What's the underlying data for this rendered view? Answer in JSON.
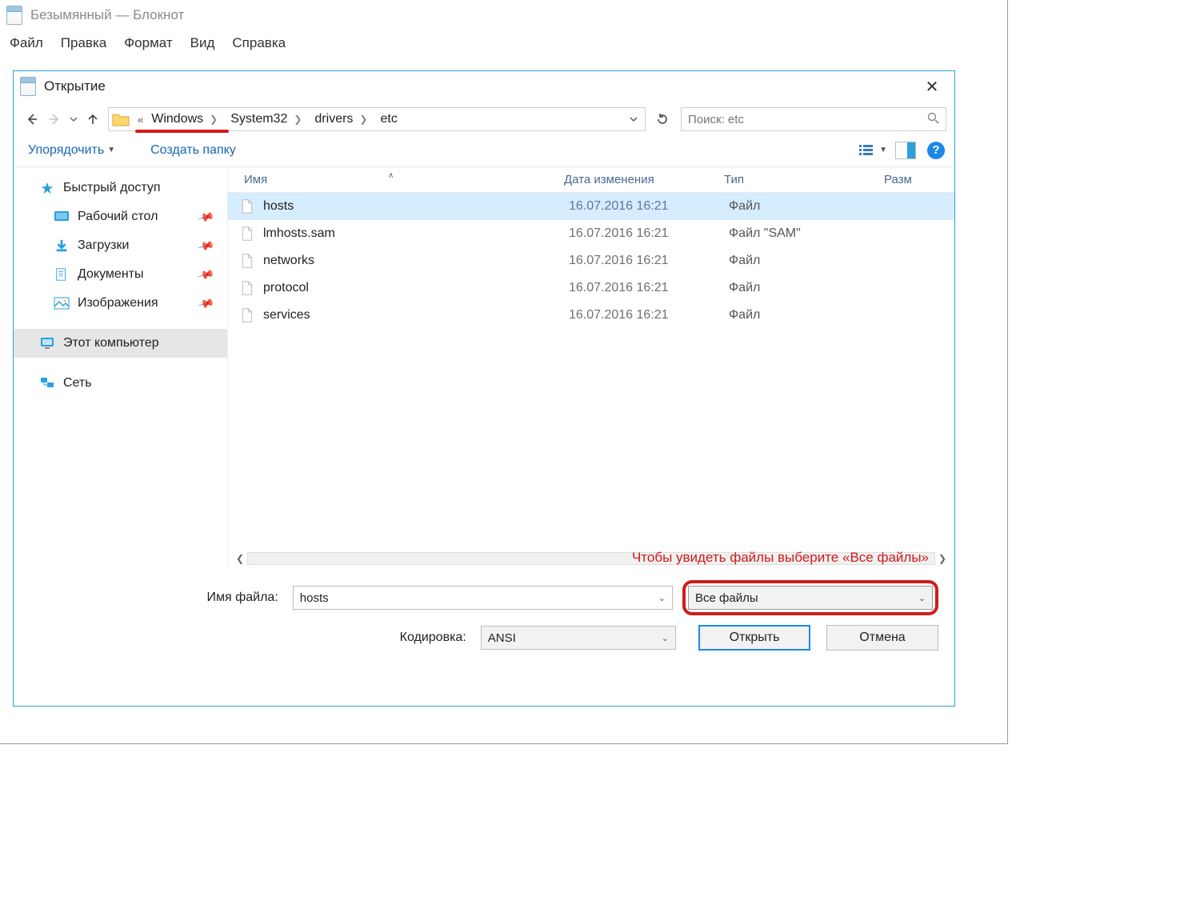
{
  "notepad": {
    "title": "Безымянный — Блокнот",
    "menu": [
      "Файл",
      "Правка",
      "Формат",
      "Вид",
      "Справка"
    ]
  },
  "dialog": {
    "title": "Открытие",
    "breadcrumb": {
      "p0": "Windows",
      "p1": "System32",
      "p2": "drivers",
      "p3": "etc"
    },
    "search_placeholder": "Поиск: etc",
    "toolbar": {
      "organize": "Упорядочить",
      "new_folder": "Создать папку"
    },
    "sidebar": {
      "quick": "Быстрый доступ",
      "desktop": "Рабочий стол",
      "downloads": "Загрузки",
      "documents": "Документы",
      "pictures": "Изображения",
      "thispc": "Этот компьютер",
      "network": "Сеть"
    },
    "columns": {
      "name": "Имя",
      "date": "Дата изменения",
      "type": "Тип",
      "size": "Разм"
    },
    "files": [
      {
        "name": "hosts",
        "date": "16.07.2016 16:21",
        "type": "Файл",
        "selected": true
      },
      {
        "name": "lmhosts.sam",
        "date": "16.07.2016 16:21",
        "type": "Файл \"SAM\"",
        "selected": false
      },
      {
        "name": "networks",
        "date": "16.07.2016 16:21",
        "type": "Файл",
        "selected": false
      },
      {
        "name": "protocol",
        "date": "16.07.2016 16:21",
        "type": "Файл",
        "selected": false
      },
      {
        "name": "services",
        "date": "16.07.2016 16:21",
        "type": "Файл",
        "selected": false
      }
    ],
    "scroll_hint": "Чтобы увидеть файлы выберите «Все файлы»",
    "filename_label": "Имя файла:",
    "filename_value": "hosts",
    "filter_value": "Все файлы",
    "encoding_label": "Кодировка:",
    "encoding_value": "ANSI",
    "open_btn": "Открыть",
    "cancel_btn": "Отмена"
  }
}
